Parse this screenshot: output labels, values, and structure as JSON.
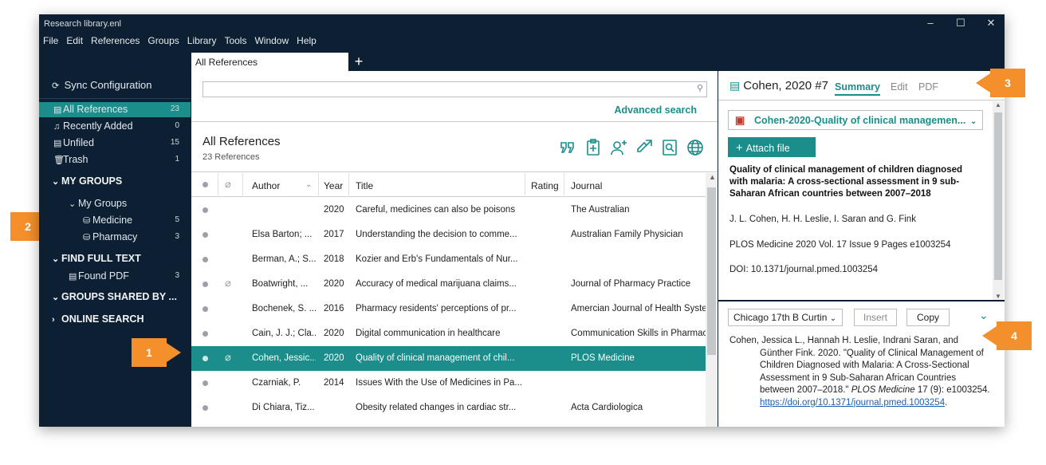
{
  "window": {
    "title": "Research library.enl",
    "controls": [
      "–",
      "☐",
      "✕"
    ]
  },
  "menu": [
    "File",
    "Edit",
    "References",
    "Groups",
    "Library",
    "Tools",
    "Window",
    "Help"
  ],
  "tabs": {
    "active": "All References",
    "add": "+"
  },
  "sidebar": {
    "sync": "Sync Configuration",
    "items": [
      {
        "label": "All References",
        "count": "23"
      },
      {
        "label": "Recently Added",
        "count": "0"
      },
      {
        "label": "Unfiled",
        "count": "15"
      },
      {
        "label": "Trash",
        "count": "1"
      }
    ],
    "my_groups_header": "MY GROUPS",
    "my_groups_folder": "My Groups",
    "groups": [
      {
        "label": "Medicine",
        "count": "5"
      },
      {
        "label": "Pharmacy",
        "count": "3"
      }
    ],
    "find_full_text_header": "FIND FULL TEXT",
    "found_pdf": {
      "label": "Found PDF",
      "count": "3"
    },
    "groups_shared_header": "GROUPS SHARED BY ...",
    "online_search_header": "ONLINE SEARCH"
  },
  "search": {
    "value": "",
    "advanced": "Advanced search"
  },
  "list": {
    "title": "All References",
    "count": "23 References",
    "columns": {
      "author": "Author",
      "year": "Year",
      "title": "Title",
      "rating": "Rating",
      "journal": "Journal"
    },
    "rows": [
      {
        "author": "",
        "year": "2020",
        "title": "Careful, medicines can also be poisons",
        "journal": "The Australian",
        "attach": false
      },
      {
        "author": "Elsa Barton; ...",
        "year": "2017",
        "title": "Understanding the decision to comme...",
        "journal": "Australian Family Physician",
        "attach": false
      },
      {
        "author": "Berman, A.; S...",
        "year": "2018",
        "title": "Kozier and Erb's Fundamentals of Nur...",
        "journal": "",
        "attach": false
      },
      {
        "author": "Boatwright, ...",
        "year": "2020",
        "title": "Accuracy of medical marijuana claims...",
        "journal": "Journal of Pharmacy Practice",
        "attach": true
      },
      {
        "author": "Bochenek, S. ...",
        "year": "2016",
        "title": "Pharmacy residents' perceptions of pr...",
        "journal": "Amercian Journal of Health Syste",
        "attach": false
      },
      {
        "author": "Cain, J. J.; Cla...",
        "year": "2020",
        "title": "Digital communication in healthcare",
        "journal": "Communication Skills in Pharmac",
        "attach": false
      },
      {
        "author": "Cohen, Jessic...",
        "year": "2020",
        "title": "Quality of clinical management of chil...",
        "journal": "PLOS Medicine",
        "attach": true
      },
      {
        "author": "Czarniak, P.",
        "year": "2014",
        "title": "Issues With the Use of Medicines in Pa...",
        "journal": "",
        "attach": false
      },
      {
        "author": "Di Chiara, Tiz...",
        "year": "",
        "title": "Obesity related changes in cardiac str...",
        "journal": "Acta Cardiologica",
        "attach": false
      }
    ],
    "selected_index": 6
  },
  "reference": {
    "header": "Cohen, 2020 #7",
    "tabs": [
      "Summary",
      "Edit",
      "PDF"
    ],
    "pdf_file": "Cohen-2020-Quality of clinical managemen...",
    "attach_label": "Attach file",
    "title": "Quality of clinical management of children diagnosed with malaria: A cross-sectional assessment in 9 sub-Saharan African countries between 2007–2018",
    "authors": "J. L. Cohen, H. H. Leslie, I. Saran and G. Fink",
    "source": "PLOS Medicine 2020 Vol. 17 Issue 9 Pages e1003254",
    "doi": "DOI: 10.1371/journal.pmed.1003254"
  },
  "citation": {
    "style": "Chicago 17th B Curtin",
    "insert": "Insert",
    "copy": "Copy",
    "text_1": "Cohen, Jessica L., Hannah H. Leslie, Indrani Saran, and Günther Fink. 2020. \"Quality of Clinical Management of Children Diagnosed with Malaria: A Cross-Sectional Assessment in 9 Sub-Saharan African Countries between 2007–2018.\" ",
    "journal": "PLOS Medicine",
    "text_2": " 17 (9): e1003254. ",
    "link": "https://doi.org/10.1371/journal.pmed.1003254",
    "text_3": "."
  },
  "callouts": [
    "1",
    "2",
    "3",
    "4"
  ],
  "colors": {
    "accent": "#1b8d8a",
    "dark": "#0d1f33",
    "callout": "#f3902b"
  }
}
